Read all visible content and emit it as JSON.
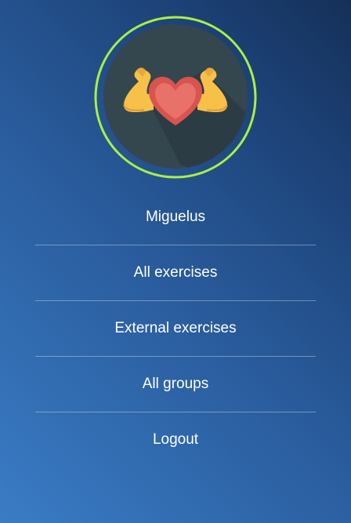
{
  "avatar": {
    "icon": "flexed-arms-heart-icon",
    "ring_color": "#a9f042",
    "background_color": "#34474f"
  },
  "menu": {
    "user_name": "Miguelus",
    "items": [
      {
        "label": "All exercises"
      },
      {
        "label": "External exercises"
      },
      {
        "label": "All groups"
      },
      {
        "label": "Logout"
      }
    ]
  }
}
